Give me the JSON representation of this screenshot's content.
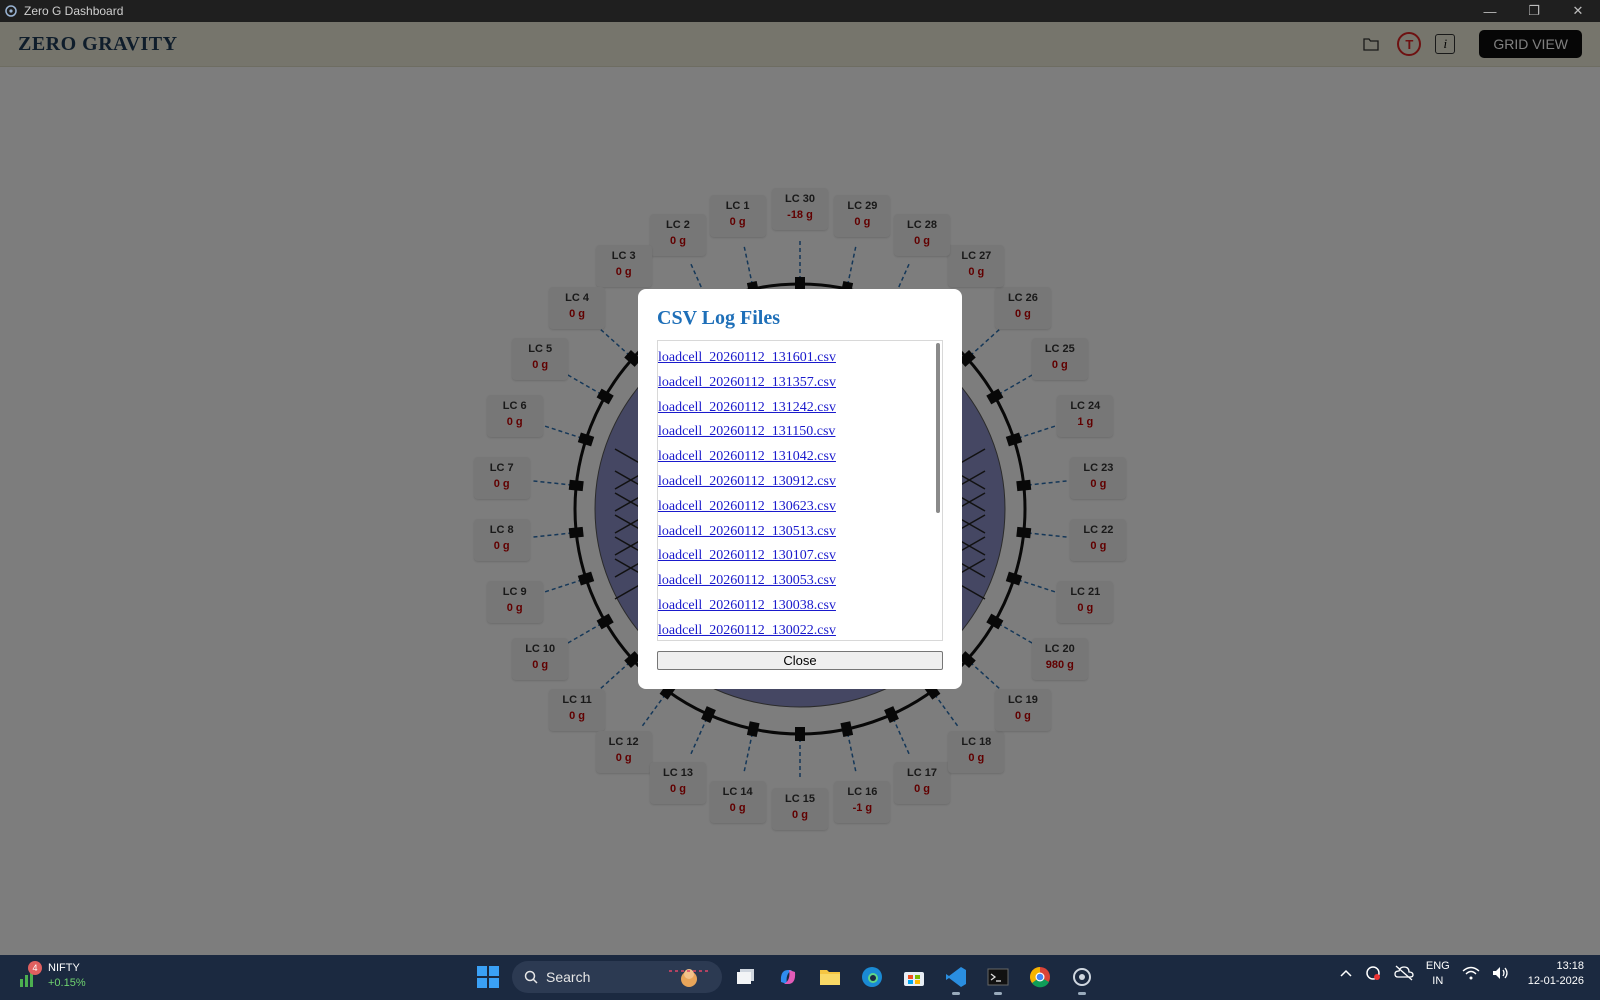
{
  "window": {
    "title": "Zero G Dashboard",
    "minimize": "—",
    "restore": "❐",
    "close": "✕"
  },
  "header": {
    "brand": "ZERO GRAVITY",
    "t_label": "T",
    "i_label": "i",
    "grid_view_label": "GRID VIEW",
    "folder_icon": "folder-icon",
    "info_icon": "info-icon"
  },
  "load_cells": [
    {
      "label": "LC 1",
      "value": "0 g"
    },
    {
      "label": "LC 2",
      "value": "0 g"
    },
    {
      "label": "LC 3",
      "value": "0 g"
    },
    {
      "label": "LC 4",
      "value": "0 g"
    },
    {
      "label": "LC 5",
      "value": "0 g"
    },
    {
      "label": "LC 6",
      "value": "0 g"
    },
    {
      "label": "LC 7",
      "value": "0 g"
    },
    {
      "label": "LC 8",
      "value": "0 g"
    },
    {
      "label": "LC 9",
      "value": "0 g"
    },
    {
      "label": "LC 10",
      "value": "0 g"
    },
    {
      "label": "LC 11",
      "value": "0 g"
    },
    {
      "label": "LC 12",
      "value": "0 g"
    },
    {
      "label": "LC 13",
      "value": "0 g"
    },
    {
      "label": "LC 14",
      "value": "0 g"
    },
    {
      "label": "LC 15",
      "value": "0 g"
    },
    {
      "label": "LC 16",
      "value": "-1 g"
    },
    {
      "label": "LC 17",
      "value": "0 g"
    },
    {
      "label": "LC 18",
      "value": "0 g"
    },
    {
      "label": "LC 19",
      "value": "0 g"
    },
    {
      "label": "LC 20",
      "value": "980 g"
    },
    {
      "label": "LC 21",
      "value": "0 g"
    },
    {
      "label": "LC 22",
      "value": "0 g"
    },
    {
      "label": "LC 23",
      "value": "0 g"
    },
    {
      "label": "LC 24",
      "value": "1 g"
    },
    {
      "label": "LC 25",
      "value": "0 g"
    },
    {
      "label": "LC 26",
      "value": "0 g"
    },
    {
      "label": "LC 27",
      "value": "0 g"
    },
    {
      "label": "LC 28",
      "value": "0 g"
    },
    {
      "label": "LC 29",
      "value": "0 g"
    },
    {
      "label": "LC 30",
      "value": "-18 g"
    }
  ],
  "modal": {
    "title": "CSV Log Files",
    "files": [
      "loadcell_20260112_131601.csv",
      "loadcell_20260112_131357.csv",
      "loadcell_20260112_131242.csv",
      "loadcell_20260112_131150.csv",
      "loadcell_20260112_131042.csv",
      "loadcell_20260112_130912.csv",
      "loadcell_20260112_130623.csv",
      "loadcell_20260112_130513.csv",
      "loadcell_20260112_130107.csv",
      "loadcell_20260112_130053.csv",
      "loadcell_20260112_130038.csv",
      "loadcell_20260112_130022.csv"
    ],
    "close_label": "Close"
  },
  "taskbar": {
    "nifty_badge": "4",
    "nifty_label": "NIFTY",
    "nifty_change": "+0.15%",
    "search_label": "Search",
    "lang_top": "ENG",
    "lang_bottom": "IN",
    "time": "13:18",
    "date": "12-01-2026",
    "apps": [
      "task-view-icon",
      "copilot-icon",
      "file-explorer-icon",
      "edge-icon",
      "store-icon",
      "vscode-icon",
      "terminal-icon",
      "chrome-icon",
      "electron-app-icon"
    ]
  },
  "colors": {
    "accent": "#1e6fb8",
    "value_red": "#c20000",
    "header_bg": "#ecebd9"
  }
}
